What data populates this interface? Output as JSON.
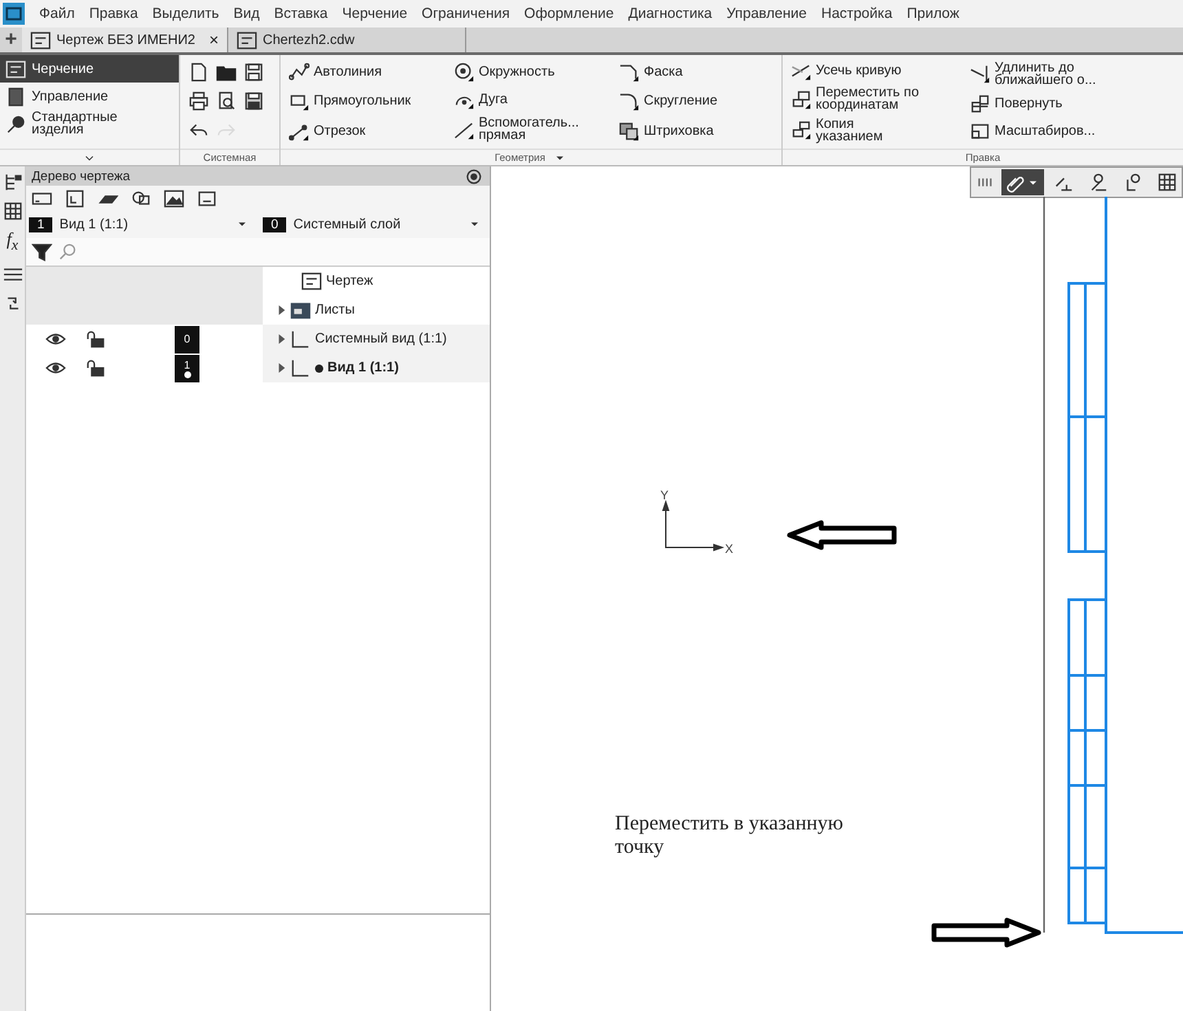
{
  "menu": [
    "Файл",
    "Правка",
    "Выделить",
    "Вид",
    "Вставка",
    "Черчение",
    "Ограничения",
    "Оформление",
    "Диагностика",
    "Управление",
    "Настройка",
    "Прилож"
  ],
  "new_tab_button": "+",
  "tabs": [
    {
      "label": "Чертеж БЕЗ ИМЕНИ2",
      "selected": true,
      "close": "×"
    },
    {
      "label": "Chertezh2.cdw",
      "selected": false
    }
  ],
  "modes": [
    {
      "label": "Черчение",
      "selected": true
    },
    {
      "label": "Управление",
      "selected": false
    },
    {
      "label": "Стандартные\nизделия",
      "selected": false
    }
  ],
  "ribbon_groups": [
    {
      "kind": "icons",
      "title": "Системная",
      "buttons": [
        {
          "disabled": false
        },
        {
          "disabled": false
        },
        {
          "disabled": false
        },
        {
          "disabled": false
        },
        {
          "disabled": false
        },
        {
          "disabled": false
        },
        {
          "disabled": false
        },
        {
          "disabled": true
        }
      ]
    },
    {
      "kind": "tools",
      "title": "Геометрия",
      "columns": [
        [
          "Автолиния",
          "Прямоугольник",
          "Отрезок"
        ],
        [
          "Окружность",
          "Дуга",
          "Вспомогатель...\nпрямая"
        ],
        [
          "Фаска",
          "Скругление",
          "Штриховка"
        ]
      ]
    },
    {
      "kind": "tools",
      "title": "Правка",
      "columns": [
        [
          "Усечь кривую",
          "Переместить по\nкоординатам",
          "Копия\nуказанием"
        ],
        [
          "Удлинить до\nближайшего о...",
          "Повернуть",
          "Масштабиров..."
        ]
      ]
    }
  ],
  "side_tabs": [
    {
      "kind": "tree"
    },
    {
      "kind": "grid"
    },
    {
      "kind": "formula",
      "label": "f$_{x}$"
    },
    {
      "kind": "layers"
    },
    {
      "kind": "numbering"
    }
  ],
  "tree_panel": {
    "title": "Дерево чертежа",
    "view_select": {
      "badge": "1",
      "value": "Вид 1 (1:1)"
    },
    "layer_select": {
      "badge": "0",
      "value": "Системный слой"
    },
    "tree": {
      "label": "Чертеж",
      "children": [
        {
          "label": "Листы",
          "kind": "sheets",
          "expanded": false
        },
        {
          "label": "Системный вид (1:1)",
          "kind": "view",
          "expanded": false,
          "visible": true,
          "locked": false,
          "layer": "0",
          "current": false
        },
        {
          "label": "Вид 1 (1:1)",
          "kind": "view",
          "expanded": false,
          "visible": true,
          "locked": false,
          "layer": "1",
          "current": true
        }
      ]
    }
  },
  "canvas": {
    "axis_labels": {
      "x": "X",
      "y": "Y"
    },
    "note": "Переместить в указанную точку",
    "snap_buttons": [
      {
        "selected": true
      },
      {
        "selected": false
      },
      {
        "selected": false
      },
      {
        "selected": false
      },
      {
        "selected": false
      }
    ]
  }
}
